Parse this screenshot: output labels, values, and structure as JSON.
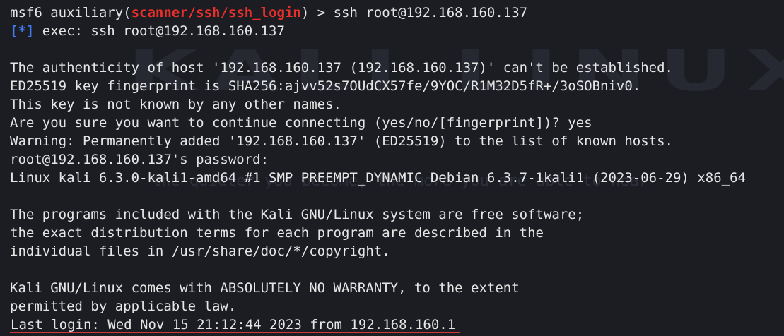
{
  "watermark": {
    "logo": "KALI LINUX",
    "tagline": "the quieter you become, the more you are able to hear"
  },
  "prompt": {
    "name": "msf6",
    "pre": " auxiliary(",
    "module": "scanner/ssh/ssh_login",
    "post": ") > ssh root@192.168.160.137"
  },
  "exec_line": {
    "tag": "[*]",
    "text": " exec: ssh root@192.168.160.137"
  },
  "output": {
    "auth_line": "The authenticity of host '192.168.160.137 (192.168.160.137)' can't be established.",
    "fingerprint_line": "ED25519 key fingerprint is SHA256:ajvv52s7OUdCX57fe/9YOC/R1M32D5fR+/3oSOBniv0.",
    "unknown_line": "This key is not known by any other names.",
    "confirm_line": "Are you sure you want to continue connecting (yes/no/[fingerprint])? yes",
    "warning_line": "Warning: Permanently added '192.168.160.137' (ED25519) to the list of known hosts.",
    "password_line": "root@192.168.160.137's password:",
    "kernel_line": "Linux kali 6.3.0-kali1-amd64 #1 SMP PREEMPT_DYNAMIC Debian 6.3.7-1kali1 (2023-06-29) x86_64",
    "programs_line1": "The programs included with the Kali GNU/Linux system are free software;",
    "programs_line2": "the exact distribution terms for each program are described in the",
    "programs_line3": "individual files in /usr/share/doc/*/copyright.",
    "warranty_line1": "Kali GNU/Linux comes with ABSOLUTELY NO WARRANTY, to the extent",
    "warranty_line2": "permitted by applicable law.",
    "last_login": "Last login: Wed Nov 15 21:12:44 2023 from 192.168.160.1"
  },
  "colors": {
    "background": "#1b1d23",
    "text": "#e6e6e6",
    "module": "#e8302a",
    "tag": "#3f7cf0",
    "highlight_border": "#cc3a3a"
  }
}
